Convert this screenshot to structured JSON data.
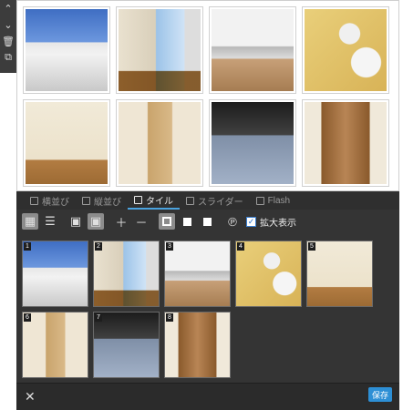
{
  "toolbar": {
    "items": [
      {
        "name": "chevron-up-icon",
        "glyph": "⌃"
      },
      {
        "name": "chevron-down-icon",
        "glyph": "⌄"
      },
      {
        "name": "trash-icon",
        "glyph": "🗑"
      },
      {
        "name": "copy-icon",
        "glyph": "⧉"
      }
    ]
  },
  "preview_photos": [
    "building",
    "room1",
    "kitchen",
    "bath",
    "room2",
    "shelf",
    "balcony",
    "closet"
  ],
  "tabs": [
    {
      "label": "横並び",
      "active": false
    },
    {
      "label": "縦並び",
      "active": false
    },
    {
      "label": "タイル",
      "active": true
    },
    {
      "label": "スライダー",
      "active": false
    },
    {
      "label": "Flash",
      "active": false
    }
  ],
  "controls": {
    "zoom_label": "拡大表示",
    "zoom_checked": true
  },
  "tiles": [
    {
      "num": "1",
      "photo": "building"
    },
    {
      "num": "2",
      "photo": "room1"
    },
    {
      "num": "3",
      "photo": "kitchen"
    },
    {
      "num": "4",
      "photo": "bath"
    },
    {
      "num": "5",
      "photo": "room2"
    },
    {
      "num": "6",
      "photo": "shelf"
    },
    {
      "num": "7",
      "photo": "balcony"
    },
    {
      "num": "8",
      "photo": "closet"
    }
  ],
  "footer": {
    "close_glyph": "✕",
    "save_label": "保存"
  },
  "colors": {
    "panel_bg": "#343434",
    "accent": "#2d8fd5",
    "tab_active_underline": "#4aa3df"
  }
}
